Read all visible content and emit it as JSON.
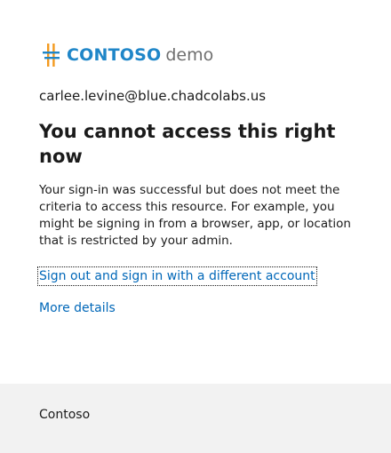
{
  "logo": {
    "brand": "CONTOSO",
    "suffix": "demo",
    "icon": "contoso-logo-icon",
    "brand_color": "#1f86c8",
    "accent_color": "#f39a1f"
  },
  "account": {
    "email": "carlee.levine@blue.chadcolabs.us"
  },
  "heading": {
    "title": "You cannot access this right now"
  },
  "message": {
    "body": "Your sign-in was successful but does not meet the criteria to access this resource. For example, you might be signing in from a browser, app, or location that is restricted by your admin."
  },
  "links": {
    "sign_out": "Sign out and sign in with a different account",
    "more_details": "More details",
    "link_color": "#0067b8"
  },
  "footer": {
    "text": "Contoso"
  }
}
